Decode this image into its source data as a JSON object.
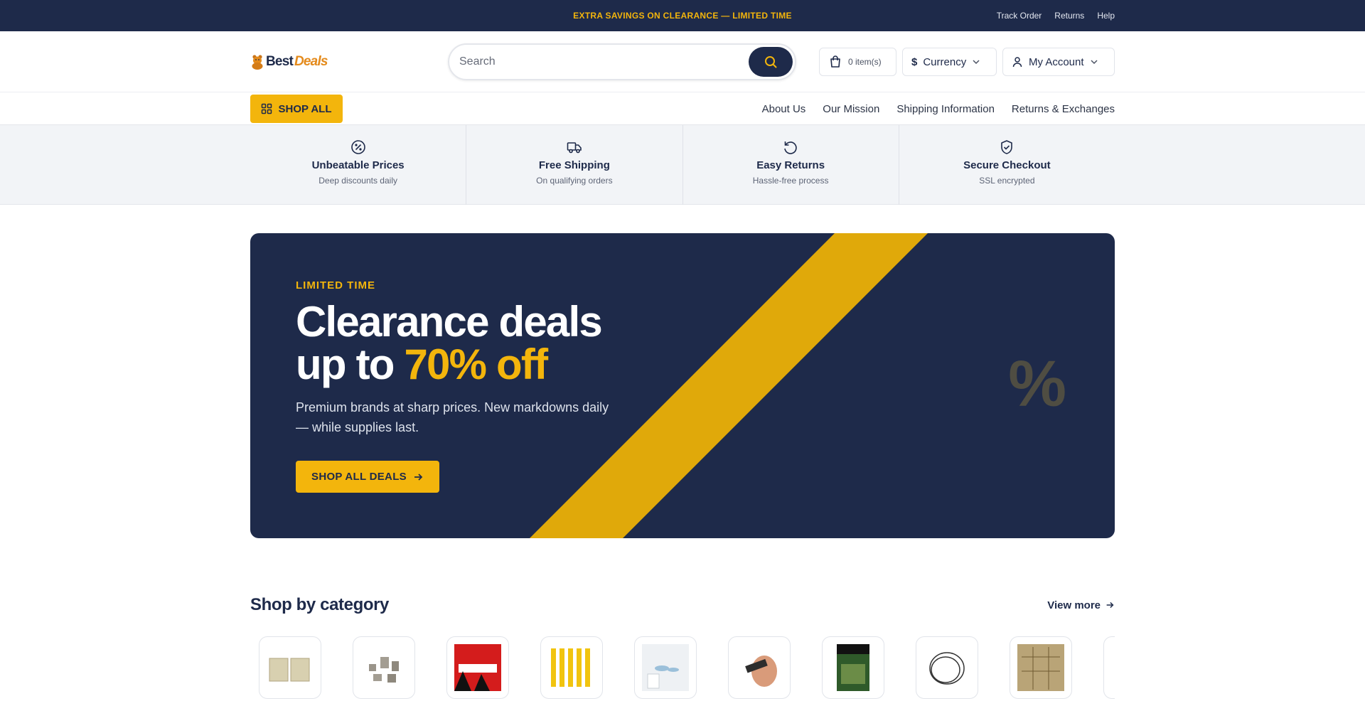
{
  "topbar": {
    "promo": "EXTRA SAVINGS ON CLEARANCE — LIMITED TIME",
    "links": [
      "Track Order",
      "Returns",
      "Help"
    ]
  },
  "header": {
    "logo_best": "Best",
    "logo_deals": "Deals",
    "search_placeholder": "Search",
    "cart_label": "0 item(s)",
    "currency_symbol": "$",
    "currency_label": "Currency",
    "account_label": "My Account"
  },
  "nav": {
    "shop_all": "SHOP ALL",
    "links": [
      "About Us",
      "Our Mission",
      "Shipping Information",
      "Returns & Exchanges"
    ]
  },
  "features": [
    {
      "title": "Unbeatable Prices",
      "subtitle": "Deep discounts daily",
      "icon": "discount-icon"
    },
    {
      "title": "Free Shipping",
      "subtitle": "On qualifying orders",
      "icon": "truck-icon"
    },
    {
      "title": "Easy Returns",
      "subtitle": "Hassle-free process",
      "icon": "return-icon"
    },
    {
      "title": "Secure Checkout",
      "subtitle": "SSL encrypted",
      "icon": "shield-check-icon"
    }
  ],
  "hero": {
    "kicker": "LIMITED TIME",
    "title_line1": "Clearance deals",
    "title_line2_prefix": "up to ",
    "title_highlight": "70% off",
    "subtitle": "Premium brands at sharp prices. New markdowns daily — while supplies last.",
    "cta": "SHOP ALL DEALS",
    "decor": "%"
  },
  "categories": {
    "heading": "Shop by category",
    "view_more": "View more",
    "items": [
      "filter-pads",
      "coins",
      "book-cover",
      "yellow-posts",
      "glass-dispenser",
      "hand-tool",
      "fly-fishing-book",
      "cable-coil",
      "map-print",
      "partial-tile"
    ]
  },
  "colors": {
    "navy": "#1e2a4a",
    "yellow": "#f3b50c",
    "orange": "#e48a1b"
  }
}
